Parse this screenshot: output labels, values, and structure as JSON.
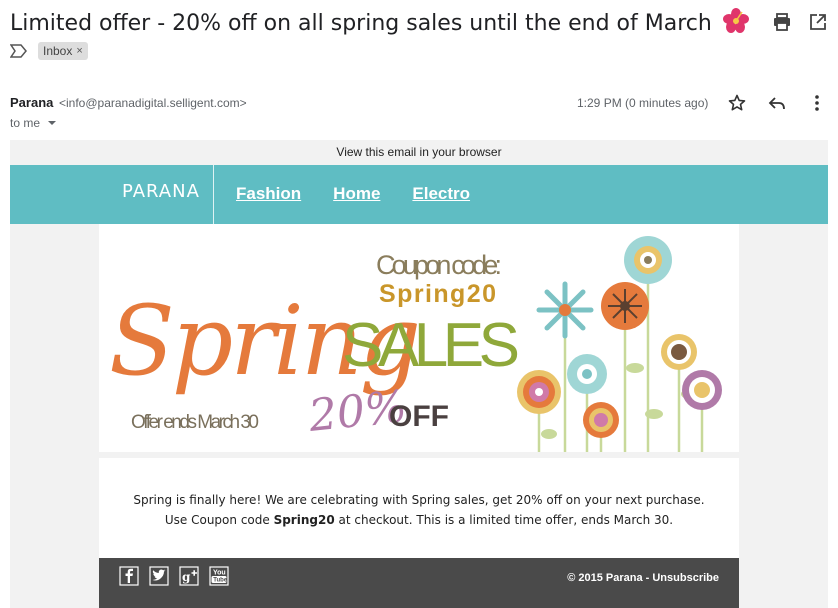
{
  "header": {
    "subject": "Limited offer - 20% off on all spring sales until the end of March",
    "subject_emoji": "hibiscus-icon",
    "label": "Inbox",
    "label_remove": "×"
  },
  "sender": {
    "name": "Parana",
    "email": "<info@paranadigital.selligent.com>",
    "to": "to me",
    "time": "1:29 PM (0 minutes ago)"
  },
  "email": {
    "view_in_browser": "View this email in your browser",
    "brand": "PARANA",
    "nav": [
      "Fashion",
      "Home",
      "Electro"
    ],
    "banner": {
      "headline": "Spring",
      "coupon_label": "Coupon code:",
      "coupon_code": "Spring20",
      "sales": "SALES",
      "discount": "20%",
      "off": "OFF",
      "offer_ends": "Offer ends March 30"
    },
    "body": {
      "text_before": "Spring is finally here! We are celebrating with Spring sales, get 20% off on your next purchase. Use Coupon code ",
      "code": "Spring20",
      "text_after": " at checkout. This is a limited time offer, ends March 30."
    },
    "footer": {
      "social": [
        "facebook-icon",
        "twitter-icon",
        "google-plus-icon",
        "youtube-icon"
      ],
      "copyright": "© 2015 Parana - ",
      "unsubscribe": "Unsubscribe"
    }
  },
  "colors": {
    "nav_bg": "#5fbdc3",
    "footer_bg": "#4a4a4a",
    "spring_orange": "#e57a3c",
    "sales_green": "#8fa83a",
    "coupon_gold": "#c9962a",
    "discount_purple": "#b07aa8"
  }
}
